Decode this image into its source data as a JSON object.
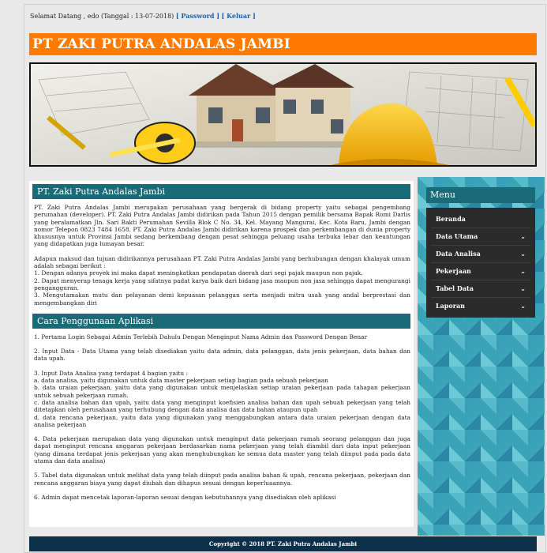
{
  "topbar": {
    "greeting": "Selamat Datang , edo (Tanggal : 13-07-2018)",
    "password_link": "[ Password ]",
    "logout_link": "[ Keluar ]"
  },
  "header": {
    "title": "PT ZAKI PUTRA ANDALAS JAMBI"
  },
  "about": {
    "title": "PT. Zaki Putra Andalas Jambi",
    "intro": "PT. Zaki Putra Andalas Jambi merupakan perusahaan yang bergerak di bidang property yaitu sebagai pengembang perumahan (developer). PT. Zaki Putra Andalas Jambi didirikan pada Tahun 2015 dengan pemilik bersama Bapak Romi Darlis yang beralamatkan Jln. Sari Bakti Perumahan Sevilla Blok C No. 34, Kel. Mayang Mangurai, Kec. Kota Baru, Jambi dengan nomor Telepon 0823 7484 1658. PT. Zaki Putra Andalas Jambi didirikan karena prospek dan perkembangan di dunia property khususnya untuk Provinsi Jambi sedang berkembang dengan pesat sehingga peluang usaha terbuka lebar dan keuntungan yang didapatkan juga lumayan besar.",
    "purpose_intro": "Adapun maksud dan tujuan didirikannya perusahaan PT. Zaki Putra Andalas Jambi yang berhubungan dengan khalayak umum adalah sebagai berikut :",
    "purpose_1": "1. Dengan adanya proyek ini maka dapat meningkatkan pendapatan daerah dari segi pajak maupun non pajak.",
    "purpose_2": "2. Dapat menyerap tenaga kerja yang sifatnya padat karya baik dari bidang jasa maupun non jasa sehingga dapat mengurangi pengangguran.",
    "purpose_3": "3. Mengutamakan mutu dan pelayanan demi kepuasan pelanggan serta menjadi mitra usah yang andal berprestasi dan mengembangkan diri"
  },
  "usage": {
    "title": "Cara Penggunaan Aplikasi",
    "step1": "1. Pertama Login Sebagai Admin Terlebih Dahulu Dengan Menginput Nama Admin dan Password Dengan Benar",
    "step2": "2. Input Data - Data Utama yang telah disediakan yaitu data admin, data pelanggan, data jenis pekerjaan, data bahan dan data upah.",
    "step3_title": "3. Input Data Analisa yang terdapat 4 bagian yaitu :",
    "step3_a": "a. data analisa, yaitu digunakan untuk data master pekerjaan setiap bagian pada sebuah pekerjaan",
    "step3_b": "b. data uraian pekerjaan, yaitu data yang digunakan untuk menjelaskan setiap uraian pekerjaan pada tahapan pekerjaan untuk sebuah pekerjaan rumah.",
    "step3_c": "c. data analisa bahan dan upah, yaitu data yang menginput koefisien analisa bahan dan upah sebuah pekerjaan yang telah ditetapkan oleh perusahaan yang terhubung dengan data analisa dan data bahan ataupun upah",
    "step3_d": "d. data rencana pekerjaan, yaitu data yang digunakan yang menggabungkan antara data uraian pekerjaan dengan data analisa pekerjaan",
    "step4": "4. Data pekerjaan merupakan data yang digunakan untuk menginput data pekerjaan rumah seorang pelanggan dan juga dapat menginput rencana anggaran pekerjaan berdasarkan nama pekerjaan yang telah diambil dari data input pekerjaan (yang dimana terdapat jenis pekerjaan yang akan menghubungkan ke semua data master yang telah diinput pada pada data utama dan data analisa)",
    "step5": "5. Tabel data digunakan untuk melihat data yang telah diinput pada analisa bahan & upah, rencana pekerjaan, pekerjaan dan rencana anggaran biaya yang dapat diubah dan dihapus sesuai dengan keperluaannya.",
    "step6": "6. Admin dapat mencetak laporan-laporan sesuai dengan kebutuhannya yang disediakan oleh aplikasi"
  },
  "sidebar": {
    "title": "Menu",
    "items": [
      {
        "label": "Beranda",
        "chevron": ""
      },
      {
        "label": "Data Utama",
        "chevron": "⌄"
      },
      {
        "label": "Data Analisa",
        "chevron": "⌄"
      },
      {
        "label": "Pekerjaan",
        "chevron": "⌄"
      },
      {
        "label": "Tabel Data",
        "chevron": "⌄"
      },
      {
        "label": "Laporan",
        "chevron": "⌄"
      }
    ]
  },
  "footer": {
    "copyright": "Copyright © 2018 PT. Zaki Putra Andalas Jambi"
  },
  "colors": {
    "accent": "#ff7a00",
    "section": "#1a6b78",
    "footer": "#0c2f4a"
  }
}
